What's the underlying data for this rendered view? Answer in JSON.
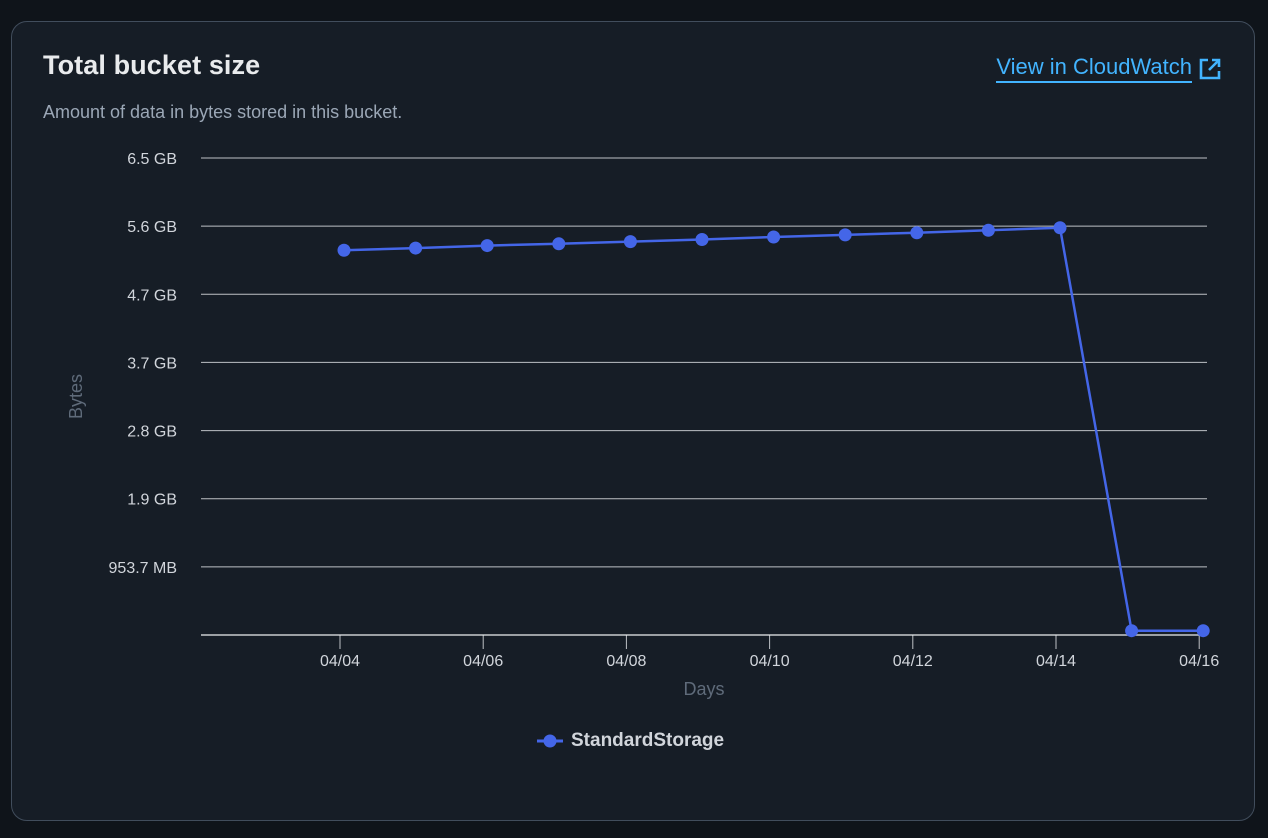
{
  "card": {
    "title": "Total bucket size",
    "subtitle": "Amount of data in bytes stored in this bucket.",
    "link_label": "View in CloudWatch",
    "link_icon": "external-link-icon"
  },
  "colors": {
    "series": "#4466e8",
    "link": "#42b4ff",
    "grid": "#e9ebed"
  },
  "chart_data": {
    "type": "line",
    "xlabel": "Days",
    "ylabel": "Bytes",
    "y_ticks": [
      {
        "value": 0,
        "label": ""
      },
      {
        "value": 953.7,
        "label": "953.7 MB"
      },
      {
        "value": 1907.3,
        "label": "1.9 GB"
      },
      {
        "value": 2861,
        "label": "2.8 GB"
      },
      {
        "value": 3814.7,
        "label": "3.7 GB"
      },
      {
        "value": 4768.4,
        "label": "4.7 GB"
      },
      {
        "value": 5722,
        "label": "5.6 GB"
      },
      {
        "value": 6675.7,
        "label": "6.5 GB"
      }
    ],
    "y_unit": "MB",
    "ylim": [
      0,
      6675.7
    ],
    "x_ticks": [
      "04/04",
      "04/06",
      "04/08",
      "04/10",
      "04/12",
      "04/14",
      "04/16"
    ],
    "x_domain": [
      "04/02",
      "04/16"
    ],
    "grid": true,
    "legend_position": "bottom-center",
    "series": [
      {
        "name": "StandardStorage",
        "x": [
          "04/04",
          "04/05",
          "04/06",
          "04/07",
          "04/08",
          "04/09",
          "04/10",
          "04/11",
          "04/12",
          "04/13",
          "04/14",
          "04/15",
          "04/16"
        ],
        "values": [
          5385,
          5415,
          5450,
          5475,
          5505,
          5535,
          5570,
          5600,
          5630,
          5665,
          5700,
          60,
          60
        ]
      }
    ]
  }
}
